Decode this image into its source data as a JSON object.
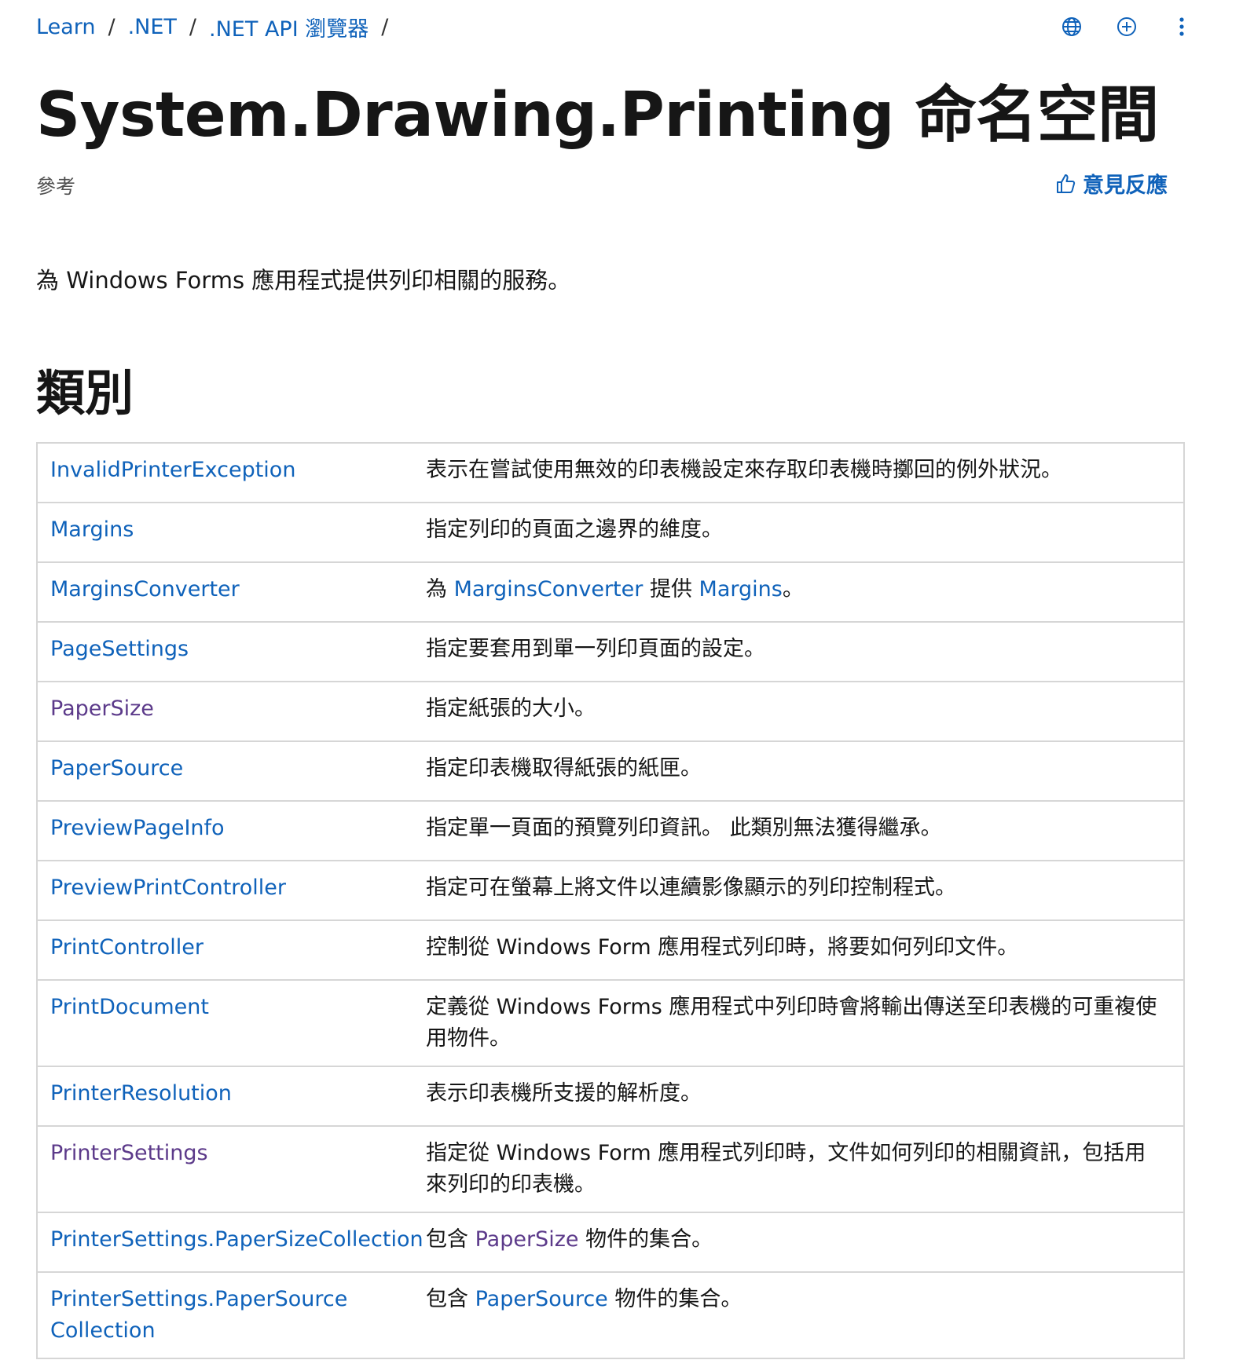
{
  "breadcrumb": [
    {
      "label": "Learn"
    },
    {
      "label": ".NET"
    },
    {
      "label": ".NET API 瀏覽器"
    }
  ],
  "breadcrumb_separator": "/",
  "icons": {
    "language": "globe-icon",
    "add": "plus-circle-icon",
    "more": "more-vertical-icon",
    "feedback": "thumbs-up-icon"
  },
  "page": {
    "title": "System.Drawing.Printing 命名空間",
    "meta_label": "參考",
    "feedback_label": "意見反應",
    "summary": "為 Windows Forms 應用程式提供列印相關的服務。"
  },
  "classes_section": {
    "heading": "類別",
    "rows": [
      {
        "name": "InvalidPrinterException",
        "visited": false,
        "desc": [
          "表示在嘗試使用無效的印表機設定來存取印表機時擲回的例外狀況。"
        ]
      },
      {
        "name": "Margins",
        "visited": false,
        "desc": [
          "指定列印的頁面之邊界的維度。"
        ]
      },
      {
        "name": "MarginsConverter",
        "visited": false,
        "desc_parts": [
          {
            "text": "為 ",
            "link": false
          },
          {
            "text": "MarginsConverter",
            "link": true,
            "visited": false
          },
          {
            "text": " 提供 ",
            "link": false
          },
          {
            "text": "Margins",
            "link": true,
            "visited": false
          },
          {
            "text": "。",
            "link": false
          }
        ]
      },
      {
        "name": "PageSettings",
        "visited": false,
        "desc": [
          "指定要套用到單一列印頁面的設定。"
        ]
      },
      {
        "name": "PaperSize",
        "visited": true,
        "desc": [
          "指定紙張的大小。"
        ]
      },
      {
        "name": "PaperSource",
        "visited": false,
        "desc": [
          "指定印表機取得紙張的紙匣。"
        ]
      },
      {
        "name": "PreviewPageInfo",
        "visited": false,
        "desc": [
          "指定單一頁面的預覽列印資訊。 此類別無法獲得繼承。"
        ]
      },
      {
        "name": "PreviewPrintController",
        "visited": false,
        "desc": [
          "指定可在螢幕上將文件以連續影像顯示的列印控制程式。"
        ]
      },
      {
        "name": "PrintController",
        "visited": false,
        "desc": [
          "控制從 Windows Form 應用程式列印時，將要如何列印文件。"
        ]
      },
      {
        "name": "PrintDocument",
        "visited": false,
        "desc": [
          "定義從 Windows Forms 應用程式中列印時會將輸出傳送至印表機的可重複使",
          "用物件。"
        ]
      },
      {
        "name": "PrinterResolution",
        "visited": false,
        "desc": [
          "表示印表機所支援的解析度。"
        ]
      },
      {
        "name": "PrinterSettings",
        "visited": true,
        "desc": [
          "指定從 Windows Form 應用程式列印時，文件如何列印的相關資訊，包括用",
          "來列印的印表機。"
        ]
      },
      {
        "name": "PrinterSettings.PaperSizeCollection",
        "visited": false,
        "desc_parts": [
          {
            "text": "包含 ",
            "link": false
          },
          {
            "text": "PaperSize",
            "link": true,
            "visited": true
          },
          {
            "text": " 物件的集合。",
            "link": false
          }
        ]
      },
      {
        "name_lines": [
          "PrinterSettings.PaperSource",
          "Collection"
        ],
        "visited": false,
        "desc_parts": [
          {
            "text": "包含 ",
            "link": false
          },
          {
            "text": "PaperSource",
            "link": true,
            "visited": false
          },
          {
            "text": " 物件的集合。",
            "link": false
          }
        ]
      }
    ]
  },
  "colors": {
    "link": "#0f62ba",
    "visited_link": "#5c3a8a",
    "text": "#161616",
    "muted": "#505050",
    "border": "#d6d6d6"
  }
}
